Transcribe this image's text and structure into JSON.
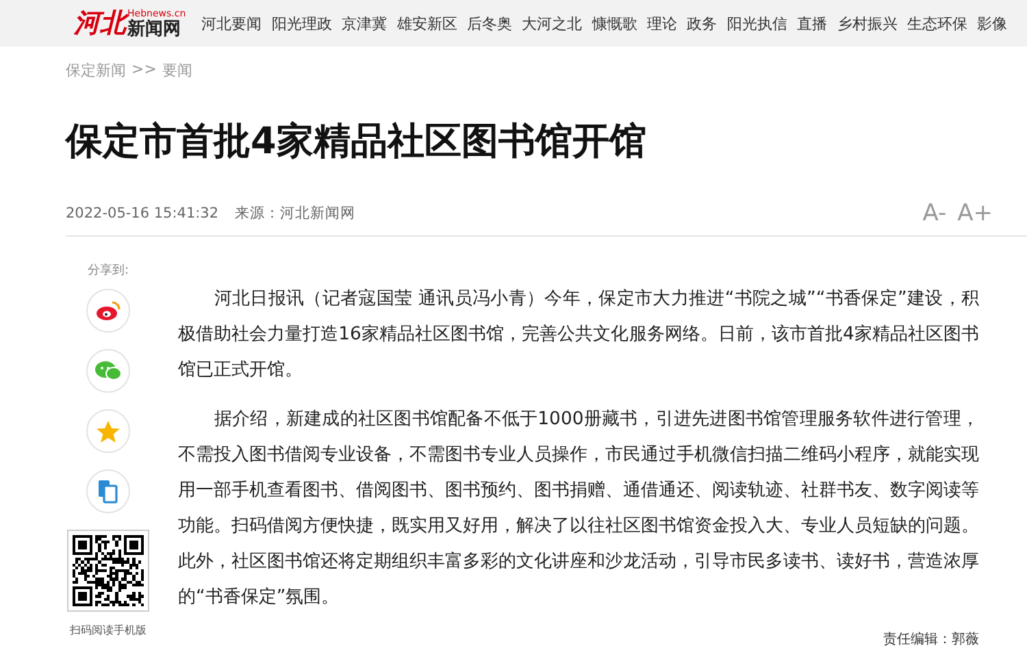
{
  "header": {
    "logo": {
      "mark": "河北",
      "domain": "Hebnews.cn",
      "name": "新闻网"
    },
    "nav": [
      "河北要闻",
      "阳光理政",
      "京津冀",
      "雄安新区",
      "后冬奥",
      "大河之北",
      "慷慨歌",
      "理论",
      "政务",
      "阳光执信",
      "直播",
      "乡村振兴",
      "生态环保",
      "影像"
    ]
  },
  "breadcrumb": [
    "保定新闻",
    ">>",
    "要闻"
  ],
  "article": {
    "title": "保定市首批4家精品社区图书馆开馆",
    "datetime": "2022-05-16 15:41:32",
    "source": "来源：河北新闻网",
    "font_controls": [
      "A-",
      "A+"
    ],
    "paragraphs": [
      "河北日报讯（记者寇国莹 通讯员冯小青）今年，保定市大力推进“书院之城”“书香保定”建设，积极借助社会力量打造16家精品社区图书馆，完善公共文化服务网络。日前，该市首批4家精品社区图书馆已正式开馆。",
      "据介绍，新建成的社区图书馆配备不低于1000册藏书，引进先进图书馆管理服务软件进行管理，不需投入图书借阅专业设备，不需图书专业人员操作，市民通过手机微信扫描二维码小程序，就能实现用一部手机查看图书、借阅图书、图书预约、图书捐赠、通借通还、阅读轨迹、社群书友、数字阅读等功能。扫码借阅方便快捷，既实用又好用，解决了以往社区图书馆资金投入大、专业人员短缺的问题。此外，社区图书馆还将定期组织丰富多彩的文化讲座和沙龙活动，引导市民多读书、读好书，营造浓厚的“书香保定”氛围。"
    ],
    "editor": "责任编辑：郭薇"
  },
  "share": {
    "label": "分享到:",
    "buttons": [
      {
        "kind": "weibo"
      },
      {
        "kind": "wechat"
      },
      {
        "kind": "favorite"
      },
      {
        "kind": "mobile"
      }
    ],
    "qr_caption": "扫码阅读手机版"
  }
}
